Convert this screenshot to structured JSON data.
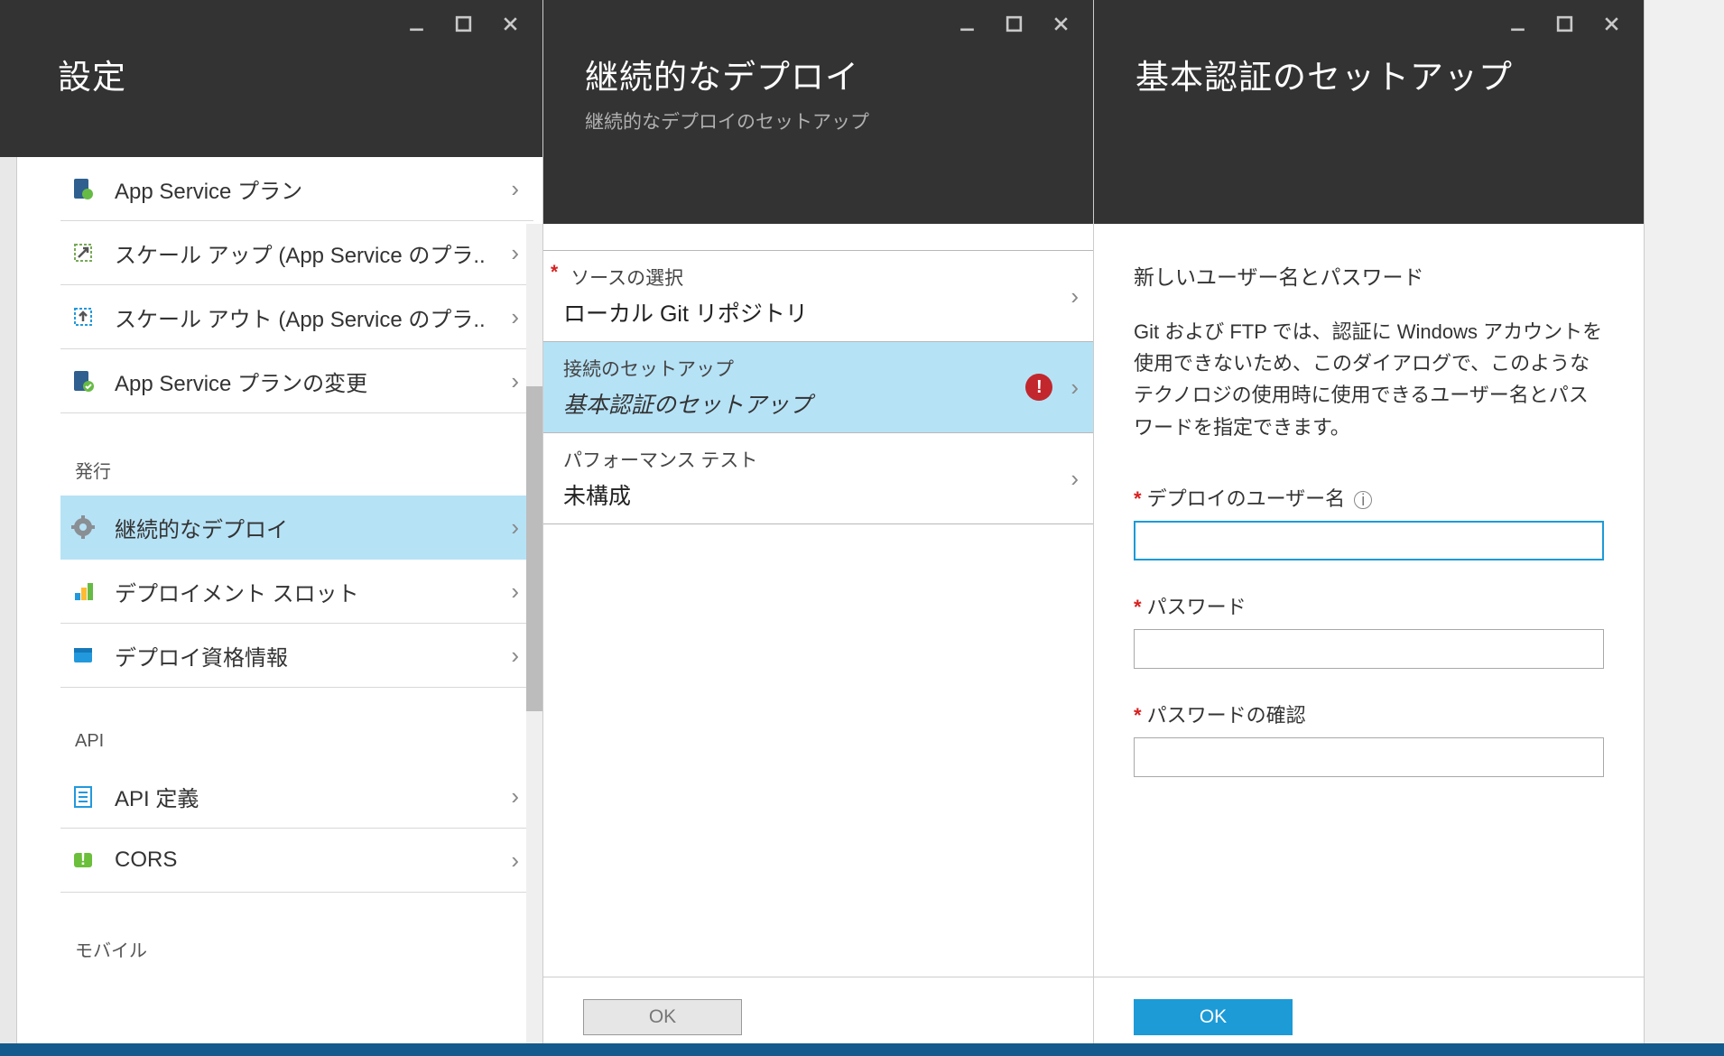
{
  "blades": {
    "settings": {
      "title": "設定"
    },
    "deploy": {
      "title": "継続的なデプロイ",
      "subtitle": "継続的なデプロイのセットアップ"
    },
    "auth": {
      "title": "基本認証のセットアップ"
    }
  },
  "settings_menu": {
    "items": [
      {
        "label": "App Service プラン"
      },
      {
        "label": "スケール アップ (App Service のプラ.."
      },
      {
        "label": "スケール アウト (App Service のプラ.."
      },
      {
        "label": "App Service プランの変更"
      }
    ],
    "section_publish": "発行",
    "publish_items": [
      {
        "label": "継続的なデプロイ",
        "selected": true
      },
      {
        "label": "デプロイメント スロット"
      },
      {
        "label": "デプロイ資格情報"
      }
    ],
    "section_api": "API",
    "api_items": [
      {
        "label": "API 定義"
      },
      {
        "label": "CORS"
      }
    ],
    "section_mobile": "モバイル"
  },
  "deploy_panel": {
    "source": {
      "label": "ソースの選択",
      "value": "ローカル Git リポジトリ"
    },
    "connection": {
      "label": "接続のセットアップ",
      "value": "基本認証のセットアップ",
      "error": "!"
    },
    "perf": {
      "label": "パフォーマンス テスト",
      "value": "未構成"
    },
    "ok": "OK"
  },
  "auth_form": {
    "heading": "新しいユーザー名とパスワード",
    "description": "Git および FTP では、認証に Windows アカウントを使用できないため、このダイアログで、このようなテクノロジの使用時に使用できるユーザー名とパスワードを指定できます。",
    "username_label": "デプロイのユーザー名",
    "password_label": "パスワード",
    "confirm_label": "パスワードの確認",
    "ok": "OK"
  }
}
